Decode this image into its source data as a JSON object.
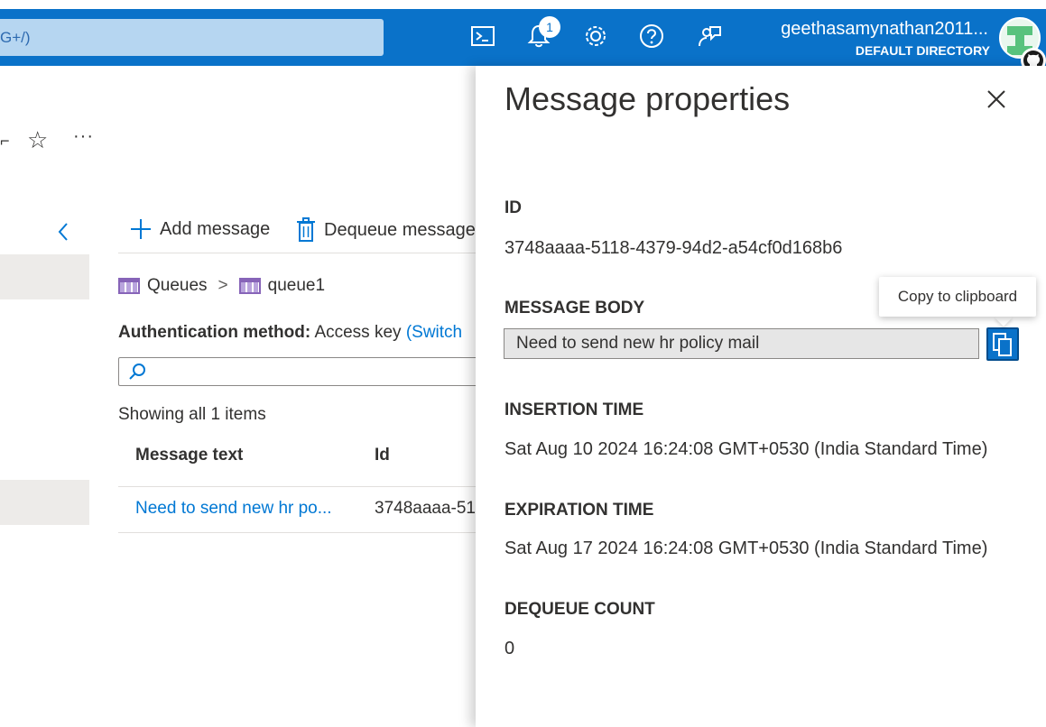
{
  "header": {
    "search_fragment": "G+/)",
    "notification_count": "1",
    "user_name": "geethasamynathan2011...",
    "user_directory": "DEFAULT DIRECTORY",
    "icons": [
      "cloud-shell-icon",
      "bell-icon",
      "gear-icon",
      "help-icon",
      "feedback-icon"
    ],
    "brand_color": "#0a72c9"
  },
  "blade": {
    "toolbar_icons": [
      "star-icon",
      "more-icon"
    ],
    "more_label": "···",
    "commands": {
      "add_message": "Add message",
      "dequeue_message": "Dequeue message"
    },
    "breadcrumb": {
      "root": "Queues",
      "separator": ">",
      "current": "queue1"
    },
    "auth": {
      "label": "Authentication method:",
      "value": "Access key",
      "switch_link": "(Switch"
    },
    "showing": "Showing all 1 items",
    "table": {
      "columns": [
        "Message text",
        "Id"
      ],
      "rows": [
        {
          "message_text": "Need to send new hr po...",
          "id": "3748aaaa-51"
        }
      ]
    }
  },
  "panel": {
    "title": "Message properties",
    "id_label": "ID",
    "id_value": "3748aaaa-5118-4379-94d2-a54cf0d168b6",
    "body_label": "MESSAGE BODY",
    "body_value": "Need to send new hr policy mail",
    "copy_tooltip": "Copy to clipboard",
    "insertion_label": "INSERTION TIME",
    "insertion_value": "Sat Aug 10 2024 16:24:08 GMT+0530 (India Standard Time)",
    "expiration_label": "EXPIRATION TIME",
    "expiration_value": "Sat Aug 17 2024 16:24:08 GMT+0530 (India Standard Time)",
    "dequeue_label": "DEQUEUE COUNT",
    "dequeue_value": "0"
  }
}
